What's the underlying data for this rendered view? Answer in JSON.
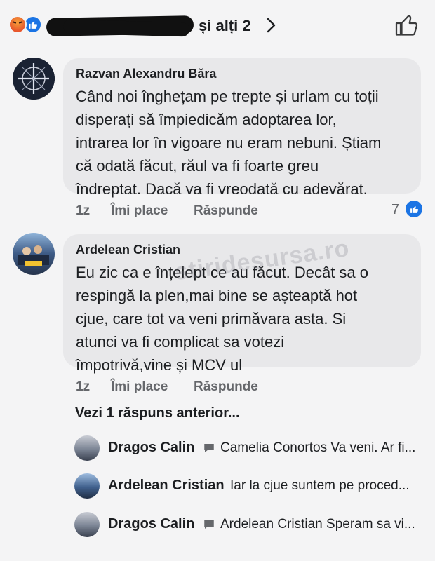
{
  "header": {
    "others_label": "și alți 2",
    "reactions": [
      "angry-reaction-icon",
      "like-reaction-icon"
    ]
  },
  "comments": [
    {
      "author": "Razvan Alexandru Băra",
      "text": "Când noi înghețam pe trepte și urlam cu toții\ndisperați să împiedicăm adoptarea lor,\nintrarea lor în vigoare nu eram nebuni. Știam\ncă odată făcut, răul va fi foarte greu\nîndreptat. Dacă va fi vreodată cu adevărat.",
      "time": "1z",
      "like_label": "Îmi place",
      "reply_label": "Răspunde",
      "like_count": "7"
    },
    {
      "author": "Ardelean Cristian",
      "text": "Eu zic ca e înțelept ce au făcut. Decât sa o\nrespingă la plen,mai bine se așteaptă hot\ncjue, care tot va veni primăvara asta. Si\natunci va fi complicat sa votezi\nîmpotrivă,vine și MCV ul",
      "time": "1z",
      "like_label": "Îmi place",
      "reply_label": "Răspunde"
    }
  ],
  "view_previous": "Vezi 1 răspuns anterior...",
  "replies": [
    {
      "author": "Dragos Calin",
      "has_reply_icon": true,
      "text": "Camelia Conortos Va veni. Ar fi..."
    },
    {
      "author": "Ardelean Cristian",
      "has_reply_icon": false,
      "text": "Iar la cjue suntem pe proced..."
    },
    {
      "author": "Dragos Calin",
      "has_reply_icon": true,
      "text": "Ardelean Cristian Speram sa vi..."
    }
  ],
  "watermark": "stiridesursa.ro",
  "colors": {
    "like_blue": "#1b74e4",
    "bubble": "#e8e8ea",
    "meta_gray": "#65676b"
  }
}
